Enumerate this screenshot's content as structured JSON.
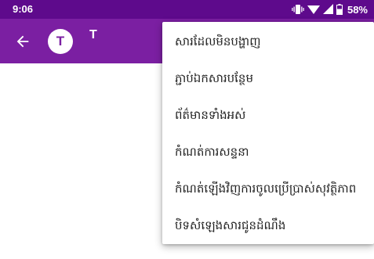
{
  "status_bar": {
    "time": "9:06",
    "battery": "58%",
    "icons": [
      "vibrate-icon",
      "wifi-icon",
      "signal-icon",
      "battery-icon"
    ]
  },
  "app_bar": {
    "color": "#7b1fa2",
    "avatar_letter": "T",
    "title": "T",
    "back_icon": "arrow-back-icon"
  },
  "menu": {
    "items": [
      {
        "label": "សារដែលមិនបង្ហាញ"
      },
      {
        "label": "ភ្ជាប់ឯកសារបន្ថែម"
      },
      {
        "label": "ព័ត៌មានទាំងអស់"
      },
      {
        "label": "កំណត់ការសន្ទនា"
      },
      {
        "label": "កំណត់ឡើងវិញការចូលប្រើប្រាស់សុវត្ថិភាព"
      },
      {
        "label": "បិទសំឡេងសារជូនដំណឹង"
      }
    ]
  }
}
